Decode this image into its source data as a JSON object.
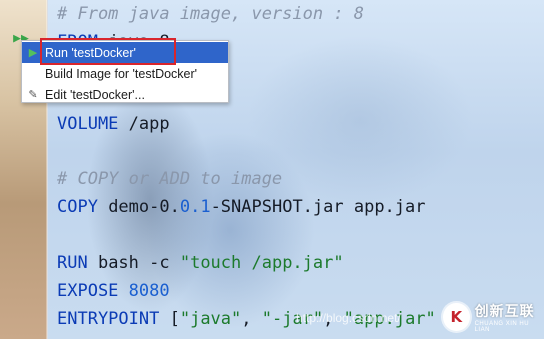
{
  "editor": {
    "lines": {
      "comment_from": "# From java image, version : 8",
      "from_kw": "FROM",
      "from_rest": " java:8",
      "volume_kw": "VOLUME",
      "volume_rest": " /app",
      "comment_copy": "# COPY or ADD to image",
      "copy_kw": "COPY",
      "copy_a": " demo-0.",
      "copy_num": "0.1",
      "copy_b": "-SNAPSHOT.jar app.jar",
      "run_kw": "RUN",
      "run_rest": " bash -c ",
      "run_str": "\"touch /app.jar\"",
      "expose_kw": "EXPOSE",
      "expose_num": " 8080",
      "entry_kw": "ENTRYPOINT",
      "entry_a": " [",
      "entry_s1": "\"java\"",
      "entry_b": ", ",
      "entry_s2": "\"-jar\"",
      "entry_c": ", ",
      "entry_s3": "\"app.jar\""
    },
    "gutter_icon": "run-arrow-icon"
  },
  "context_menu": {
    "items": [
      {
        "label": "Run 'testDocker'",
        "icon": "play-icon"
      },
      {
        "label": "Build Image for 'testDocker'",
        "icon": ""
      },
      {
        "label": "Edit 'testDocker'...",
        "icon": "edit-icon"
      }
    ]
  },
  "overlay": {
    "watermark": "http://blog.csdn.net/",
    "logo_cn": "创新互联",
    "logo_en": "CHUANG XIN HU LIAN"
  },
  "colors": {
    "selection": "#2f65ca",
    "highlight": "#d9252c",
    "keyword": "#0b3bb5",
    "string": "#1c7a2c"
  }
}
